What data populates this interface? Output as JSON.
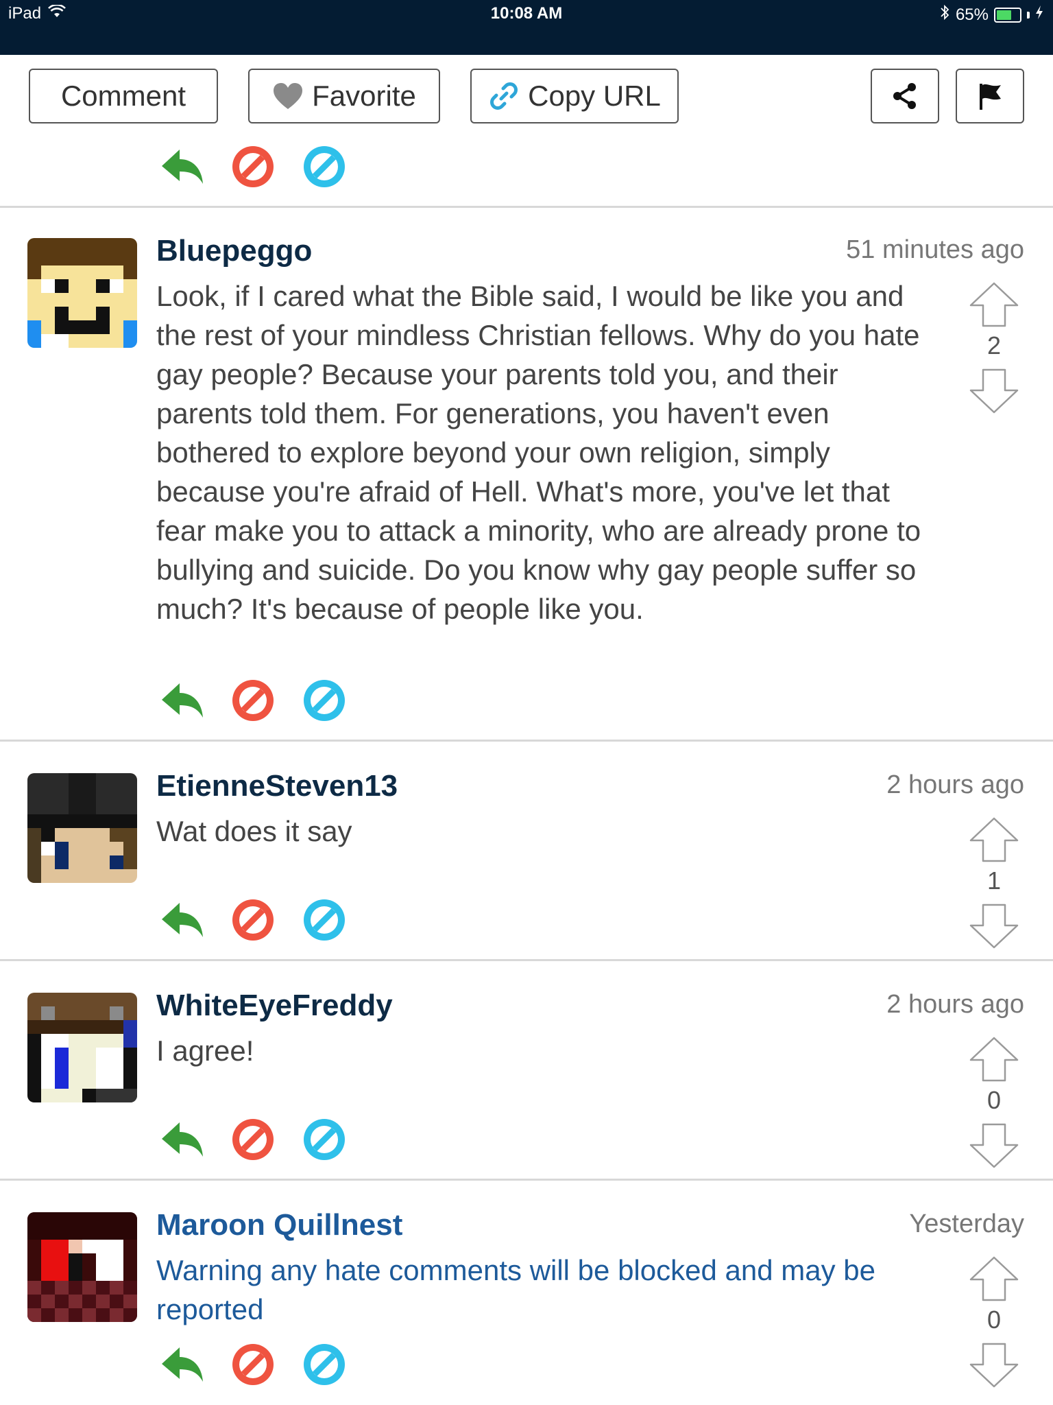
{
  "status_bar": {
    "device": "iPad",
    "time": "10:08 AM",
    "battery": "65%",
    "battery_level": 0.65
  },
  "toolbar": {
    "comment_label": "Comment",
    "favorite_label": "Favorite",
    "copy_url_label": "Copy URL"
  },
  "comments": [
    {
      "username": "Bluepeggo",
      "time": "51 minutes ago",
      "text": "Look, if I cared what the Bible said, I would be like you and the rest of your mindless Christian fellows. Why do you hate gay people? Because your parents told you, and their parents told them. For generations, you haven't even bothered to explore beyond your own religion, simply because you're afraid of Hell. What's more, you've let that fear make you to attack a minority, who are already prone to bullying and suicide. Do you know why gay people suffer so much? It's because of people like you.",
      "votes": "2"
    },
    {
      "username": "EtienneSteven13",
      "time": "2 hours ago",
      "text": "Wat does it say",
      "votes": "1"
    },
    {
      "username": "WhiteEyeFreddy",
      "time": "2 hours ago",
      "text": "I agree!",
      "votes": "0"
    },
    {
      "username": "Maroon Quillnest",
      "time": "Yesterday",
      "text": "Warning any hate comments will be blocked and may be reported",
      "votes": "0"
    }
  ],
  "icons": {
    "reply": "reply-arrow-icon",
    "block": "block-icon",
    "ignore": "ignore-icon",
    "share": "share-icon",
    "flag": "flag-icon",
    "upvote": "upvote-arrow-icon",
    "downvote": "downvote-arrow-icon"
  },
  "colors": {
    "status_bar_bg": "#041c33",
    "reply_green": "#3a9c3a",
    "block_red": "#ef5340",
    "ignore_blue": "#2ec0ea",
    "moderator_blue": "#1d5a9a"
  }
}
